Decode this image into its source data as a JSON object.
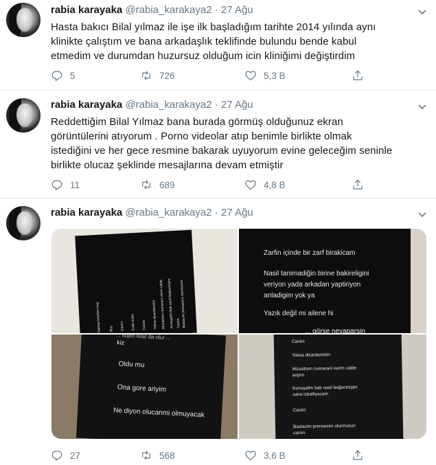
{
  "tweets": [
    {
      "name": "rabia karayaka",
      "handle": "@rabia_karakaya2",
      "separator": "·",
      "date": "27 Ağu",
      "lines": [
        "Hasta bakıcı Bilal yılmaz ile işe ilk başladığım tarihte 2014 yılında aynı",
        "klinikte çalıştım ve bana arkadaşlık teklifinde bulundu bende kabul",
        "etmedim ve durumdan huzursuz olduğum icin kliniğimi değiştirdim"
      ],
      "replies": "5",
      "retweets": "726",
      "likes": "5,3 B"
    },
    {
      "name": "rabia karayaka",
      "handle": "@rabia_karakaya2",
      "separator": "·",
      "date": "27 Ağu",
      "lines": [
        "Reddettiğim Bilal Yılmaz bana burada görmüş olduğunuz ekran",
        "görüntülerini atıyorum .  Porno videolar atıp benimle birlikte olmak",
        "istediğini ve her gece resmine bakarak uyuyorum evine geleceğim seninle",
        "birlikte olucaz şeklinde mesajlarına devam etmiştir"
      ],
      "replies": "11",
      "retweets": "689",
      "likes": "4,8 B"
    },
    {
      "name": "rabia karayaka",
      "handle": "@rabia_karakaya2",
      "separator": "·",
      "date": "27 Ağu",
      "replies": "27",
      "retweets": "568",
      "likes": "3,6 B",
      "media": {
        "photo2": [
          "Zarfin içinde bir zarf birakicam",
          "Nasil tanimadiğin birine bakireligini",
          "veriyon yada arkadan yaptiriyon",
          "anladigim yok ya",
          "Yazık değil mi ailene hi",
          "... görse neyaparsin"
        ],
        "photo3": [
          "... sujen kilat da olur ...",
          "kiz",
          "Oldu mu",
          "Ona gore ariyim",
          "Ne diyon olucanmi olmuyacak"
        ],
        "photo4": [
          "Canim",
          "Yoksa disardamisin",
          "Müsaitsen numarani verim calde",
          "ariyim",
          "Konuşalim bak nasil beğenmişim",
          "sana isbatliyacam",
          "Canim",
          "Bastacim prensesim olurmusun",
          "canim"
        ],
        "photo1": [
          "Namaz kılarken hep",
          "Boş",
          "Canim",
          "Evde misin",
          "Canim",
          "Yoksa disardamisin",
          "Müsaitsen numarani verim calde",
          "Konuşalim bak nasil beğenmişim",
          "Canim",
          "Bastacim prensesim olurmusun"
        ]
      }
    }
  ],
  "icons": {
    "reply": "reply-icon",
    "retweet": "retweet-icon",
    "like": "heart-icon",
    "share": "share-icon",
    "menu": "chevron-down-icon"
  },
  "colors": {
    "name": "#14171a",
    "secondary": "#657786",
    "divider": "#e6ecf0"
  }
}
